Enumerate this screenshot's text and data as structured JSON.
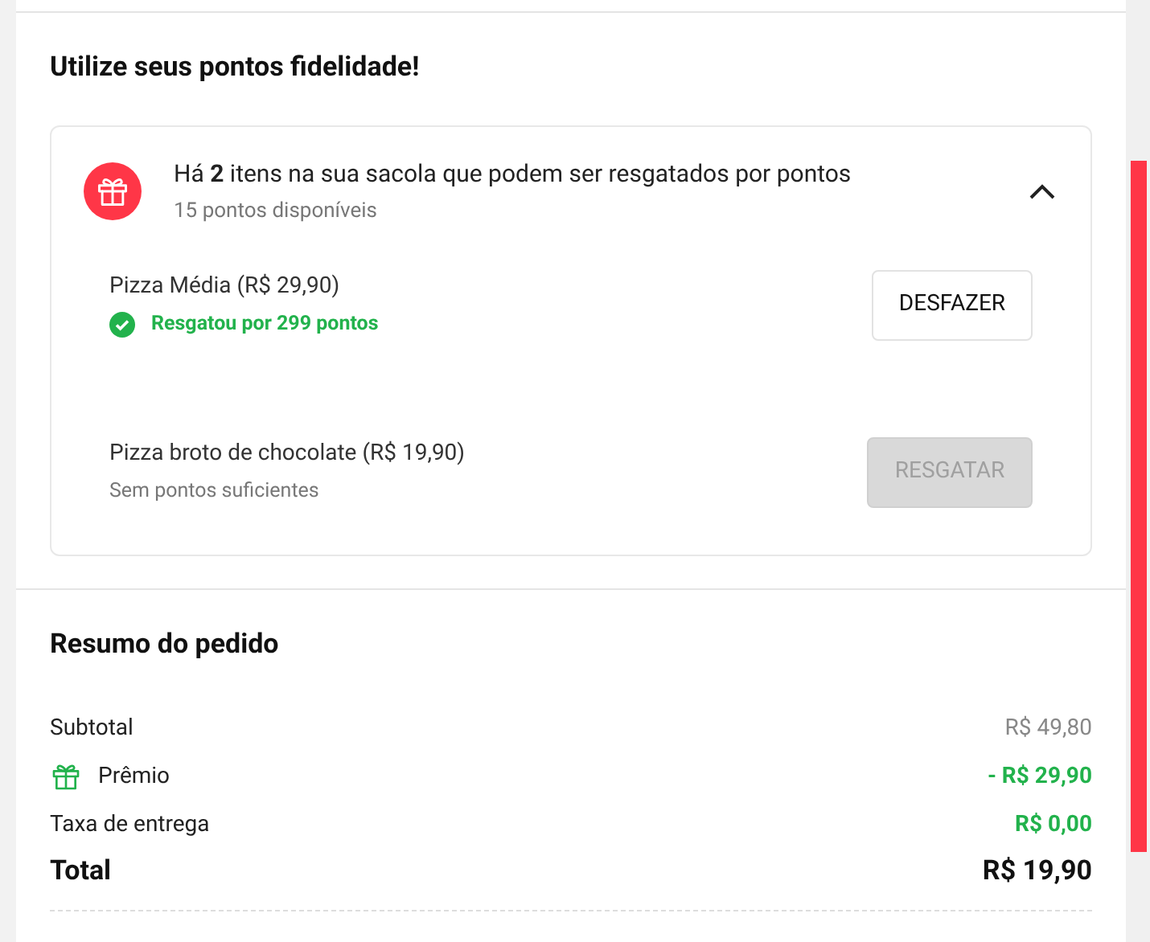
{
  "loyalty": {
    "title": "Utilize seus pontos fidelidade!",
    "banner": {
      "message": "Há **2** itens na sua sacola que podem ser resgatados por pontos",
      "points": "15 pontos disponíveis",
      "expanded": true
    },
    "items": [
      {
        "kind": "redeemed",
        "name": "Pizza Média (R$ 29,90)",
        "status": "Resgatou por 299 pontos",
        "action": "DESFAZER",
        "disabled": false
      },
      {
        "kind": "unavailable",
        "name": "Pizza broto de chocolate (R$ 19,90)",
        "status": "Sem pontos suficientes",
        "action": "RESGATAR",
        "disabled": true
      }
    ]
  },
  "summary": {
    "title": "Resumo do pedido",
    "rows": [
      {
        "kind": "subtotal",
        "label": "Subtotal",
        "value": "R$ 49,80"
      },
      {
        "kind": "reward",
        "label": "Prêmio",
        "value": "- R$ 29,90"
      },
      {
        "kind": "fee",
        "label": "Taxa de entrega",
        "value": "R$ 0,00"
      },
      {
        "kind": "total",
        "label": "Total",
        "value": "R$ 19,90"
      }
    ]
  }
}
